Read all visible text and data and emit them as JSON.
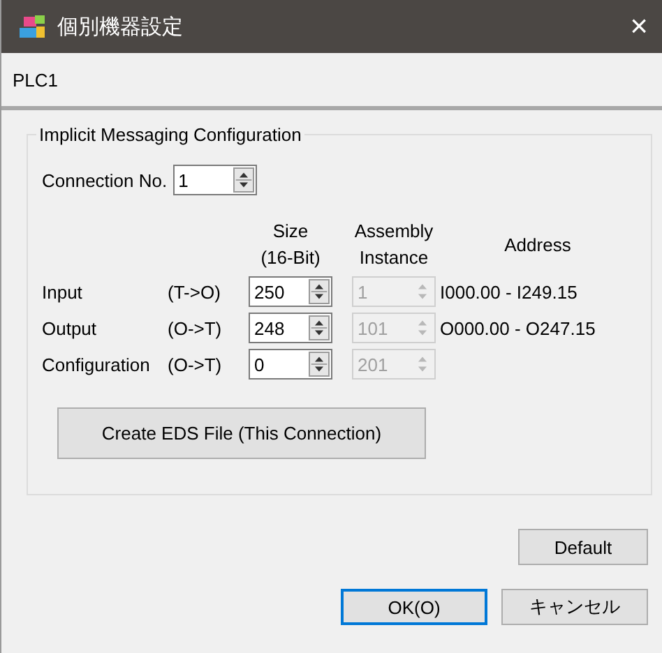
{
  "window": {
    "title": "個別機器設定",
    "close": "×"
  },
  "device": "PLC1",
  "group": {
    "title": "Implicit Messaging Configuration",
    "connection": {
      "label": "Connection No.",
      "value": "1",
      "disabled": false
    },
    "headers": [
      {
        "lines": [
          "Size",
          "(16-Bit)"
        ]
      },
      {
        "lines": [
          "Assembly",
          "Instance"
        ]
      },
      {
        "lines": [
          "Address"
        ]
      }
    ],
    "rows": [
      {
        "label": "Input",
        "direction": "(T->O)",
        "size": {
          "value": "250",
          "disabled": false
        },
        "instance": {
          "value": "1",
          "disabled": true
        },
        "address": "I000.00 - I249.15"
      },
      {
        "label": "Output",
        "direction": "(O->T)",
        "size": {
          "value": "248",
          "disabled": false
        },
        "instance": {
          "value": "101",
          "disabled": true
        },
        "address": "O000.00 - O247.15"
      },
      {
        "label": "Configuration",
        "direction": "(O->T)",
        "size": {
          "value": "0",
          "disabled": false
        },
        "instance": {
          "value": "201",
          "disabled": true
        }
      }
    ],
    "eds_button": "Create EDS File (This Connection)"
  },
  "default_button": "Default",
  "buttons": [
    {
      "label": "OK(O)",
      "focused": true
    },
    {
      "label": "キャンセル",
      "focused": false
    }
  ]
}
